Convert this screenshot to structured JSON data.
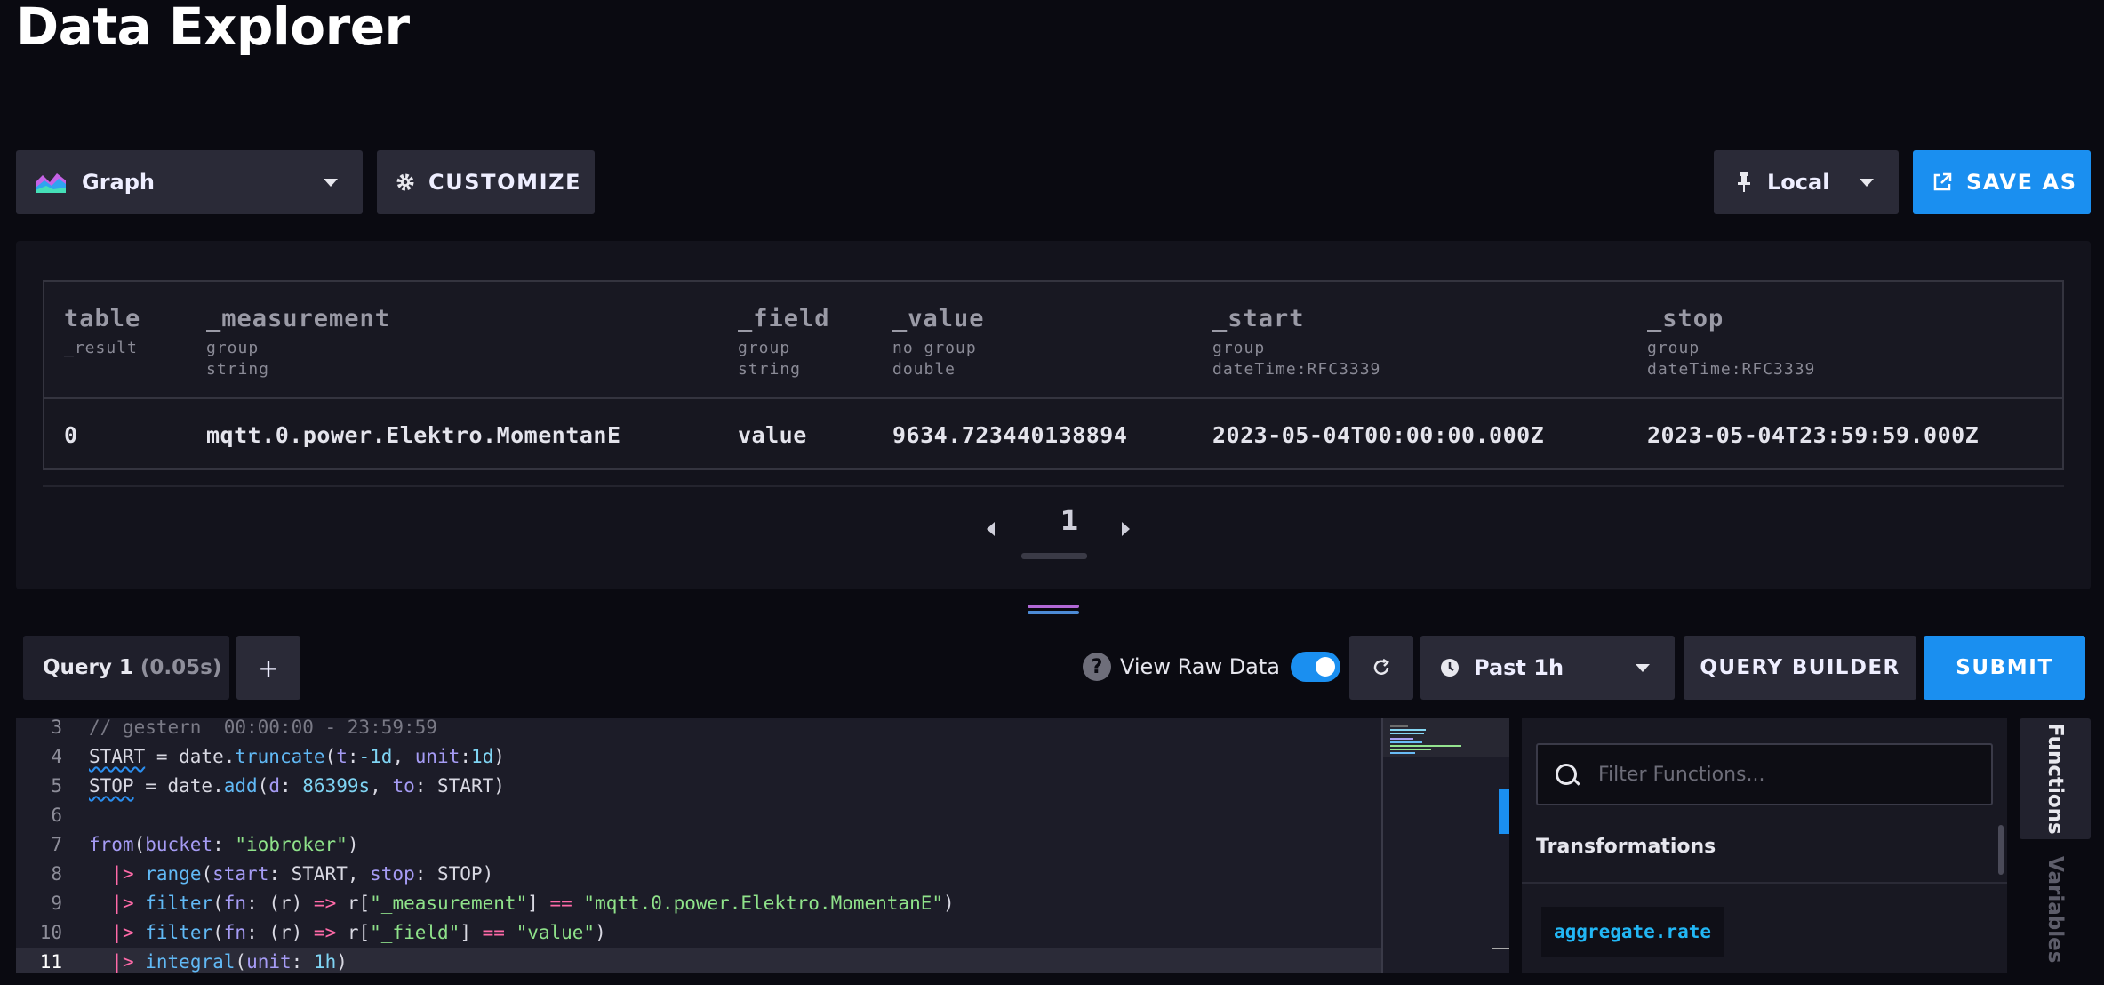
{
  "page": {
    "title": "Data Explorer"
  },
  "toolbar": {
    "visualization": "Graph",
    "customize": "CUSTOMIZE",
    "timezone": "Local",
    "save_as": "SAVE AS"
  },
  "table": {
    "columns": [
      {
        "name": "table",
        "meta1": "_result",
        "meta2": ""
      },
      {
        "name": "_measurement",
        "meta1": "group",
        "meta2": "string"
      },
      {
        "name": "_field",
        "meta1": "group",
        "meta2": "string"
      },
      {
        "name": "_value",
        "meta1": "no group",
        "meta2": "double"
      },
      {
        "name": "_start",
        "meta1": "group",
        "meta2": "dateTime:RFC3339"
      },
      {
        "name": "_stop",
        "meta1": "group",
        "meta2": "dateTime:RFC3339"
      }
    ],
    "rows": [
      [
        "0",
        "mqtt.0.power.Elektro.MomentanE",
        "value",
        "9634.723440138894",
        "2023-05-04T00:00:00.000Z",
        "2023-05-04T23:59:59.000Z"
      ]
    ],
    "page": "1"
  },
  "query": {
    "tab_label": "Query 1",
    "tab_time": "(0.05s)",
    "add": "+",
    "view_raw_label": "View Raw Data",
    "help": "?",
    "view_raw_on": true,
    "time_range": "Past 1h",
    "query_builder": "QUERY BUILDER",
    "submit": "SUBMIT"
  },
  "editor": {
    "lines": [
      {
        "n": "3",
        "text": "// gestern  00:00:00 - 23:59:59"
      },
      {
        "n": "4",
        "text": "START = date.truncate(t:-1d, unit:1d)"
      },
      {
        "n": "5",
        "text": "STOP = date.add(d: 86399s, to: START)"
      },
      {
        "n": "6",
        "text": ""
      },
      {
        "n": "7",
        "text": "from(bucket: \"iobroker\")"
      },
      {
        "n": "8",
        "text": "  |> range(start: START, stop: STOP)"
      },
      {
        "n": "9",
        "text": "  |> filter(fn: (r) => r[\"_measurement\"] == \"mqtt.0.power.Elektro.MomentanE\")"
      },
      {
        "n": "10",
        "text": "  |> filter(fn: (r) => r[\"_field\"] == \"value\")"
      },
      {
        "n": "11",
        "text": "  |> integral(unit: 1h)"
      }
    ]
  },
  "functions": {
    "search_placeholder": "Filter Functions...",
    "category": "Transformations",
    "items": [
      "aggregate.rate"
    ],
    "tabs": [
      "Functions",
      "Variables"
    ]
  },
  "colors": {
    "accent": "#1a8ff0",
    "panel": "#13131c",
    "background": "#0a0a11"
  },
  "icons": [
    "graph-icon",
    "gear-icon",
    "pin-icon",
    "external-link-icon",
    "refresh-icon",
    "clock-icon",
    "search-icon",
    "help-icon"
  ]
}
